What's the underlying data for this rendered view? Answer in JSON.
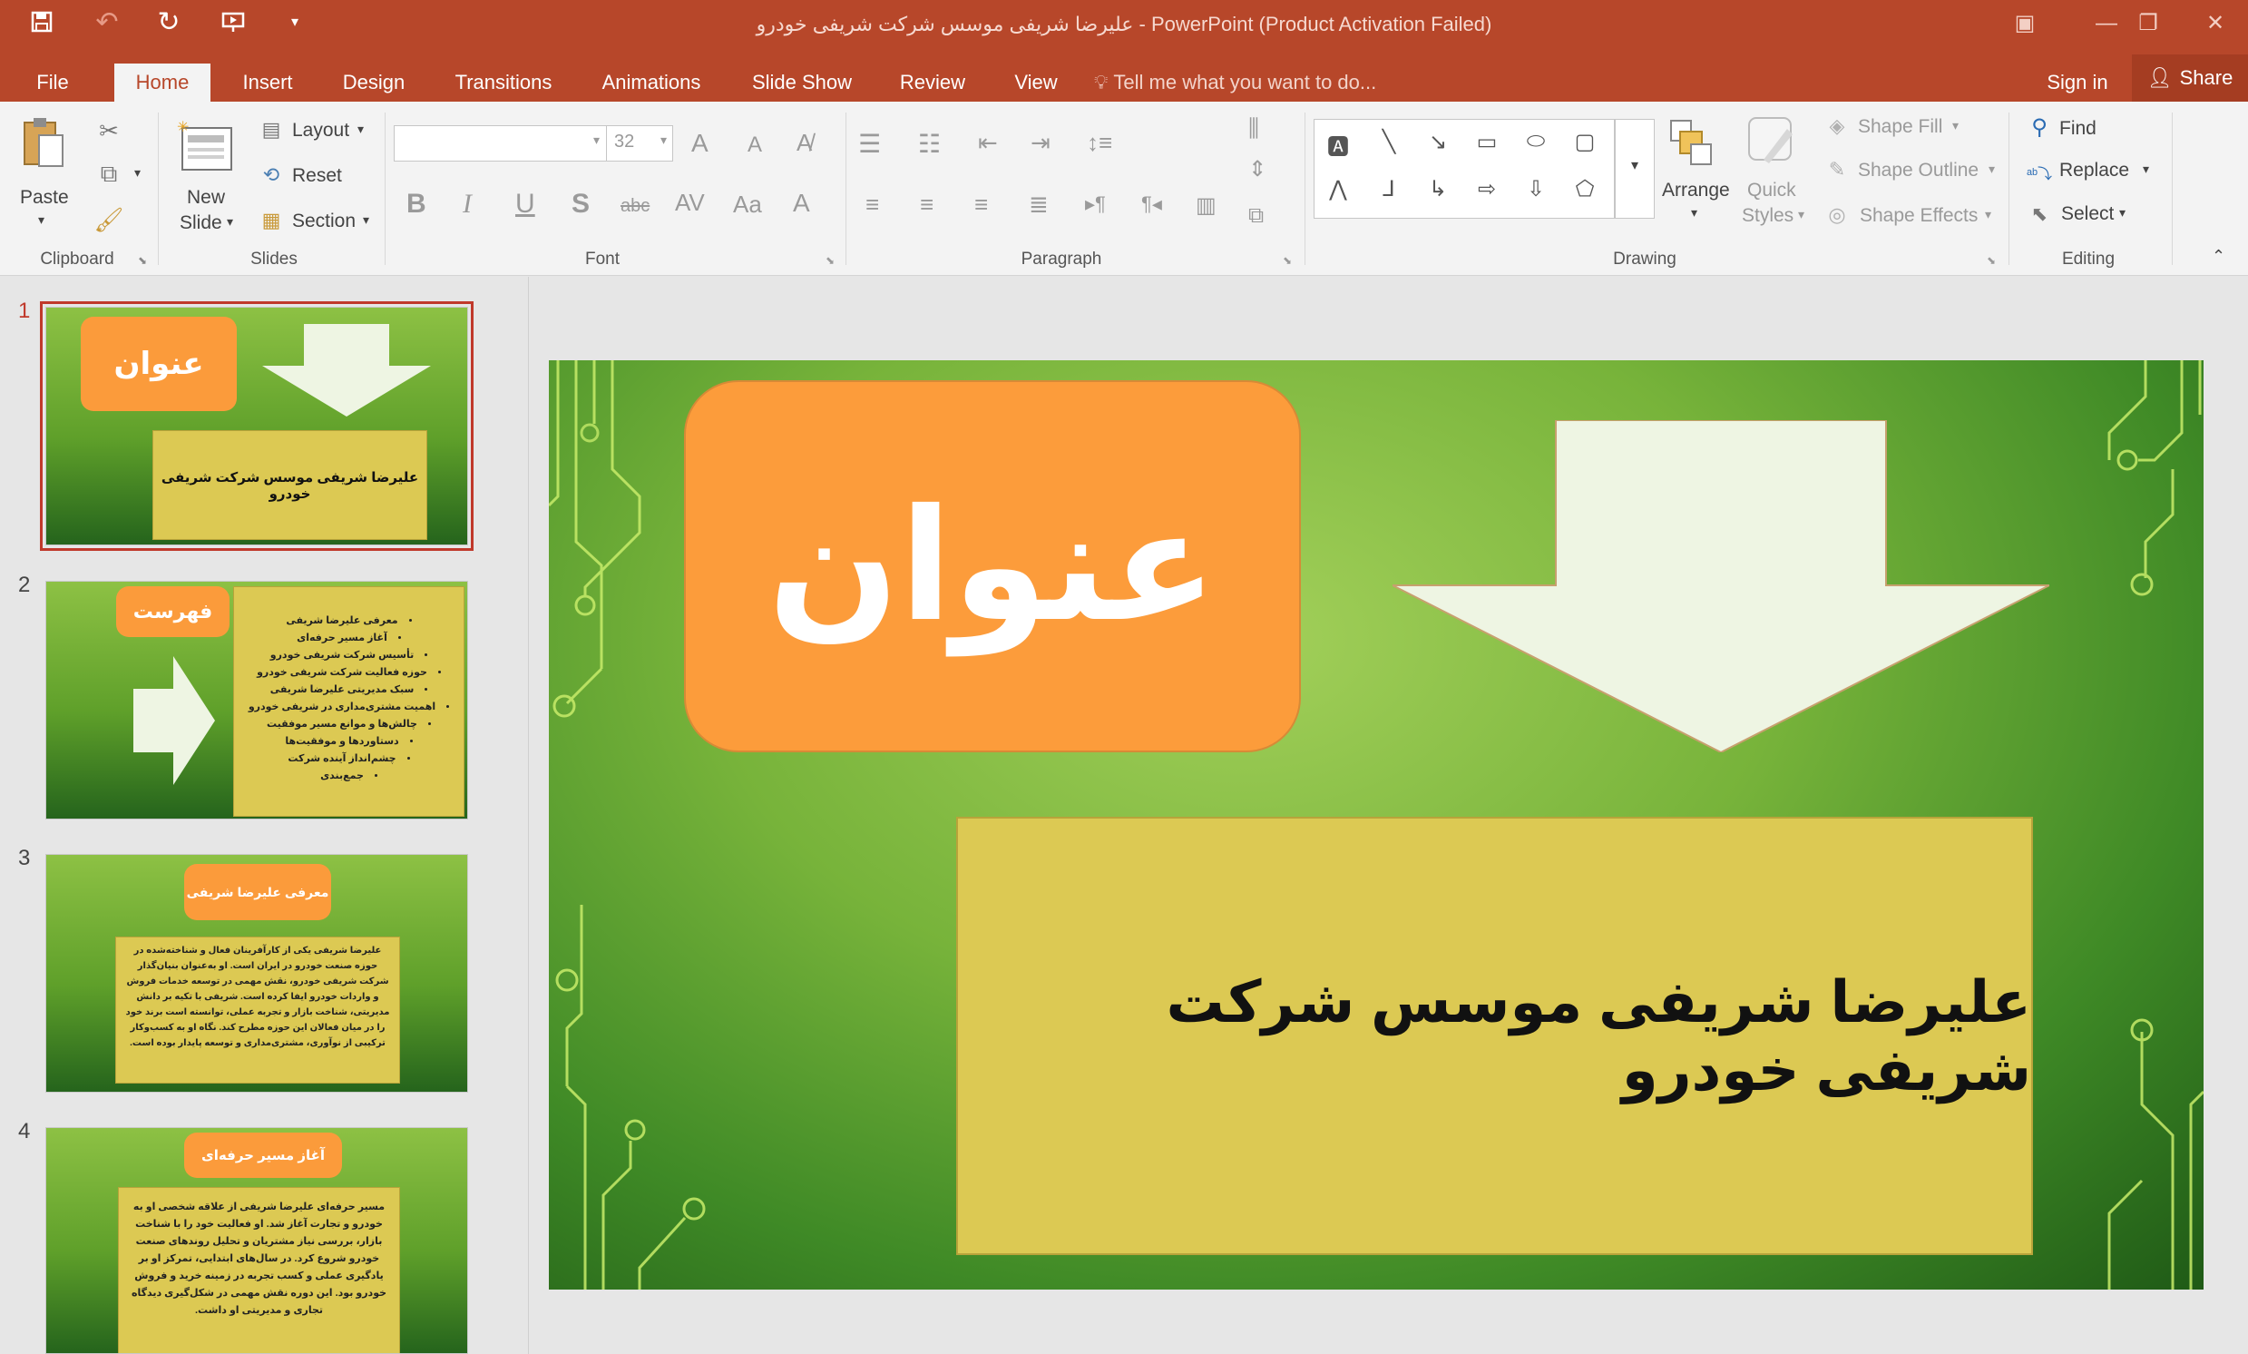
{
  "window": {
    "title": "علیرضا شریفی موسس شرکت شریفی خودرو - PowerPoint (Product Activation Failed)"
  },
  "tabs": [
    {
      "label": "File"
    },
    {
      "label": "Home"
    },
    {
      "label": "Insert"
    },
    {
      "label": "Design"
    },
    {
      "label": "Transitions"
    },
    {
      "label": "Animations"
    },
    {
      "label": "Slide Show"
    },
    {
      "label": "Review"
    },
    {
      "label": "View"
    }
  ],
  "tell_me": "Tell me what you want to do...",
  "sign_in": "Sign in",
  "share": "Share",
  "ribbon": {
    "clipboard": {
      "paste": "Paste",
      "label": "Clipboard"
    },
    "slides": {
      "new_slide_1": "New",
      "new_slide_2": "Slide",
      "layout": "Layout",
      "reset": "Reset",
      "section": "Section",
      "label": "Slides"
    },
    "font": {
      "size": "32",
      "label": "Font"
    },
    "paragraph": {
      "label": "Paragraph"
    },
    "drawing": {
      "arrange": "Arrange",
      "quick_styles_1": "Quick",
      "quick_styles_2": "Styles",
      "shape_fill": "Shape Fill",
      "shape_outline": "Shape Outline",
      "shape_effects": "Shape Effects",
      "label": "Drawing"
    },
    "editing": {
      "find": "Find",
      "replace": "Replace",
      "select": "Select",
      "label": "Editing"
    }
  },
  "slides": [
    {
      "number": "1",
      "title": "عنوان",
      "body": "علیرضا شریفی موسس شرکت شریفی خودرو"
    },
    {
      "number": "2",
      "title": "فهرست",
      "items": [
        "معرفی علیرضا شریفی",
        "آغاز مسیر حرفه‌ای",
        "تأسیس شرکت شریفی خودرو",
        "حوزه فعالیت شرکت شریفی خودرو",
        "سبک مدیریتی علیرضا شریفی",
        "اهمیت مشتری‌مداری در شریفی خودرو",
        "چالش‌ها و موانع مسیر موفقیت",
        "دستاوردها و موفقیت‌ها",
        "چشم‌انداز آینده شرکت",
        "جمع‌بندی"
      ]
    },
    {
      "number": "3",
      "title": "معرفی علیرضا شریفی",
      "body": "علیرضا شریفی یکی از کارآفرینان فعال و شناخته‌شده در حوزه صنعت خودرو در ایران است. او به‌عنوان بنیان‌گذار شرکت شریفی خودرو، نقش مهمی در توسعه خدمات فروش و واردات خودرو ایفا کرده است. شریفی با تکیه بر دانش مدیریتی، شناخت بازار و تجربه عملی، توانسته است برند خود را در میان فعالان این حوزه مطرح کند. نگاه او به کسب‌وکار ترکیبی از نوآوری، مشتری‌مداری و توسعه پایدار بوده است."
    },
    {
      "number": "4",
      "title": "آغاز مسیر حرفه‌ای",
      "body": "مسیر حرفه‌ای علیرضا شریفی از علاقه شخصی او به خودرو و تجارت آغاز شد. او فعالیت خود را با شناخت بازار، بررسی نیاز مشتریان و تحلیل روندهای صنعت خودرو شروع کرد. در سال‌های ابتدایی، تمرکز او بر یادگیری عملی و کسب تجربه در زمینه خرید و فروش خودرو بود. این دوره نقش مهمی در شکل‌گیری دیدگاه تجاری و مدیریتی او داشت."
    }
  ],
  "main_slide": {
    "title": "عنوان",
    "body": "علیرضا شریفی موسس شرکت شریفی خودرو"
  },
  "colors": {
    "accent": "#b7472a",
    "title_box": "#fc9c3b",
    "body_box": "#dcc953",
    "arrow": "#eef5e3"
  }
}
